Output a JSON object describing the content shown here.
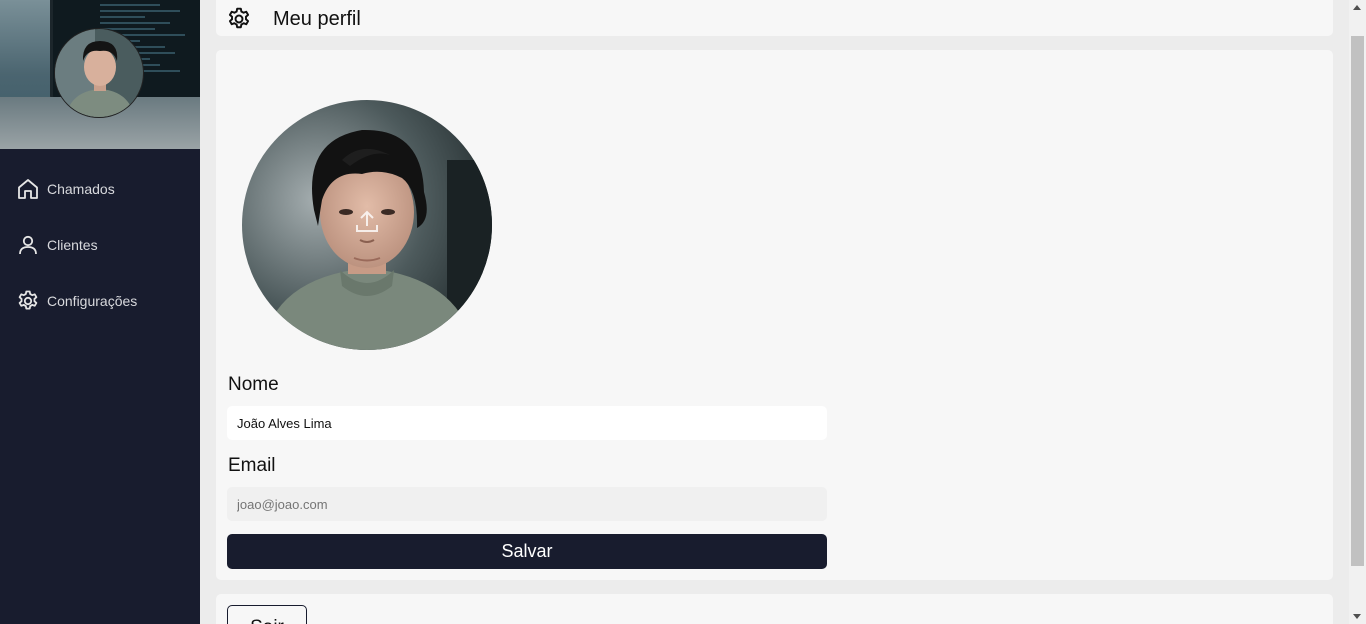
{
  "sidebar": {
    "items": [
      {
        "label": "Chamados",
        "icon": "home-icon"
      },
      {
        "label": "Clientes",
        "icon": "user-icon"
      },
      {
        "label": "Configurações",
        "icon": "gear-icon"
      }
    ]
  },
  "header": {
    "title": "Meu perfil",
    "icon": "gear-icon"
  },
  "profile": {
    "name_label": "Nome",
    "name_value": "João Alves Lima",
    "email_label": "Email",
    "email_placeholder": "joao@joao.com",
    "save_label": "Salvar",
    "upload_icon": "upload-icon"
  },
  "footer": {
    "logout_label": "Sair"
  },
  "colors": {
    "sidebar_bg": "#181c2e",
    "panel_bg": "#f7f7f7",
    "page_bg": "#ececec",
    "button_bg": "#181c2e"
  }
}
